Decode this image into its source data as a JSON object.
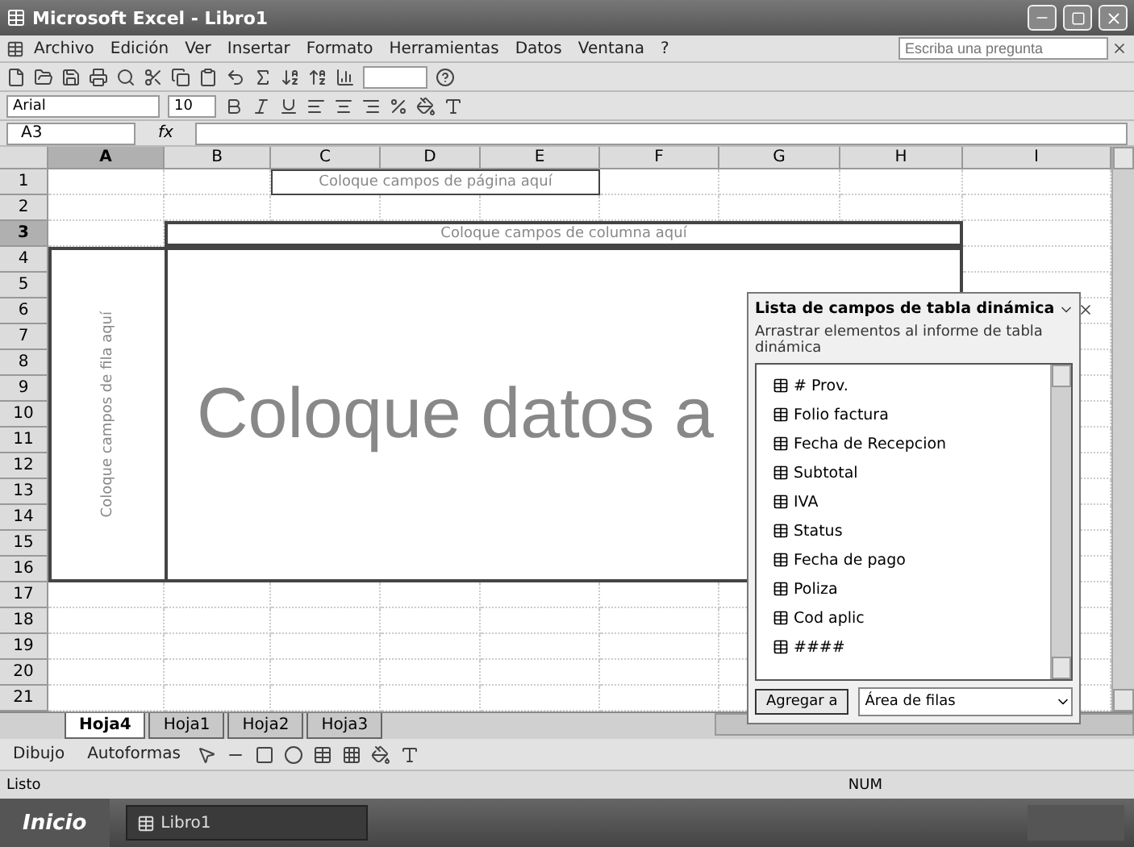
{
  "window": {
    "title": "Microsoft Excel - Libro1"
  },
  "menu": [
    "Archivo",
    "Edición",
    "Ver",
    "Insertar",
    "Formato",
    "Herramientas",
    "Datos",
    "Ventana",
    "?"
  ],
  "help_box": {
    "placeholder": "Escriba una pregunta"
  },
  "format_bar": {
    "font": "Arial",
    "size": "10"
  },
  "formula_bar": {
    "name_box": "A3",
    "fx": "fx"
  },
  "columns": [
    {
      "label": "A",
      "selected": true
    },
    {
      "label": "B",
      "selected": false
    },
    {
      "label": "C",
      "selected": false
    },
    {
      "label": "D",
      "selected": false
    },
    {
      "label": "E",
      "selected": false
    },
    {
      "label": "F",
      "selected": false
    },
    {
      "label": "G",
      "selected": false
    },
    {
      "label": "H",
      "selected": false
    },
    {
      "label": "I",
      "selected": false
    }
  ],
  "rows": [
    {
      "label": "1",
      "selected": false
    },
    {
      "label": "2",
      "selected": false
    },
    {
      "label": "3",
      "selected": true
    },
    {
      "label": "4",
      "selected": false
    },
    {
      "label": "5",
      "selected": false
    },
    {
      "label": "6",
      "selected": false
    },
    {
      "label": "7",
      "selected": false
    },
    {
      "label": "8",
      "selected": false
    },
    {
      "label": "9",
      "selected": false
    },
    {
      "label": "10",
      "selected": false
    },
    {
      "label": "11",
      "selected": false
    },
    {
      "label": "12",
      "selected": false
    },
    {
      "label": "13",
      "selected": false
    },
    {
      "label": "14",
      "selected": false
    },
    {
      "label": "15",
      "selected": false
    },
    {
      "label": "16",
      "selected": false
    },
    {
      "label": "17",
      "selected": false
    },
    {
      "label": "18",
      "selected": false
    },
    {
      "label": "19",
      "selected": false
    },
    {
      "label": "20",
      "selected": false
    },
    {
      "label": "21",
      "selected": false
    }
  ],
  "pivot": {
    "page_zone": "Coloque campos de página aquí",
    "column_zone": "Coloque campos de columna aquí",
    "row_zone": "Coloque campos de fila aquí",
    "data_zone": "Coloque datos a"
  },
  "field_list": {
    "title": "Lista de campos de tabla dinámica",
    "hint": "Arrastrar elementos al informe de tabla dinámica",
    "fields": [
      "# Prov.",
      "Folio factura",
      "Fecha de Recepcion",
      "Subtotal",
      "IVA",
      "Status",
      "Fecha de pago",
      "Poliza",
      "Cod aplic",
      "####"
    ],
    "add_button": "Agregar a",
    "area": "Área de filas"
  },
  "sheet_tabs": [
    {
      "label": "Hoja4",
      "selected": true
    },
    {
      "label": "Hoja1",
      "selected": false
    },
    {
      "label": "Hoja2",
      "selected": false
    },
    {
      "label": "Hoja3",
      "selected": false
    }
  ],
  "drawing_bar": {
    "draw": "Dibujo",
    "autoshapes": "Autoformas"
  },
  "status_bar": {
    "left": "Listo",
    "right": "NUM"
  },
  "taskbar": {
    "start": "Inicio",
    "items": [
      "Libro1"
    ]
  }
}
